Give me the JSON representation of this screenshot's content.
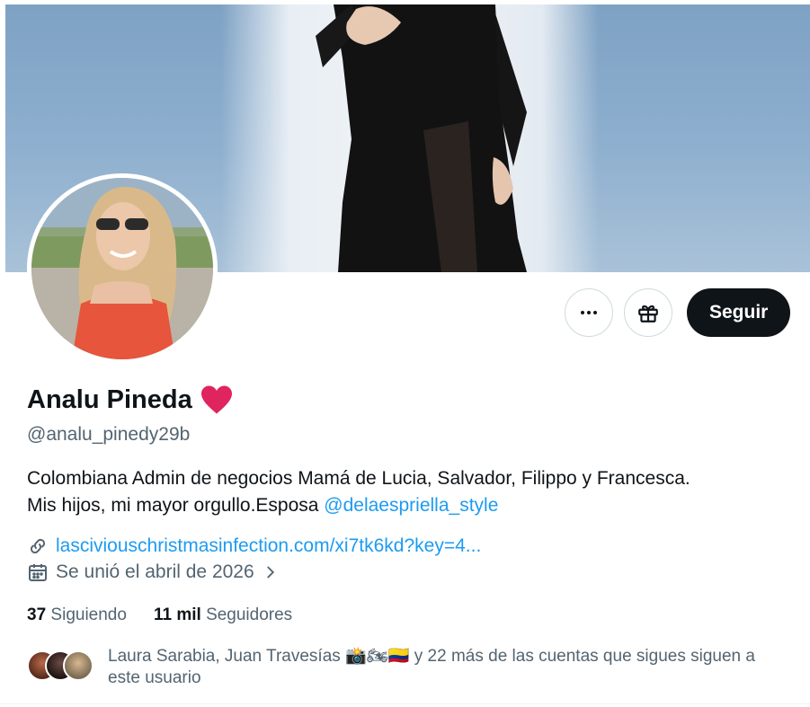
{
  "profile": {
    "name": "Analu Pineda",
    "name_emoji": "❤",
    "handle": "@analu_pinedy29b",
    "bio_line1": "Colombiana  Admin de negocios  Mamá de Lucia, Salvador, Filippo y Francesca.",
    "bio_line2": "Mis hijos, mi mayor orgullo.Esposa ",
    "bio_mention": "@delaespriella_style",
    "link": "lasciviouschristmasinfection.com/xi7tk6kd?key=4...",
    "joined": "Se unió el abril de 2026"
  },
  "actions": {
    "more_icon": "more-icon",
    "gift_icon": "gift-icon",
    "follow_label": "Seguir"
  },
  "stats": {
    "following_count": "37",
    "following_label": "Siguiendo",
    "followers_count": "11 mil",
    "followers_label": "Seguidores"
  },
  "followed_by": {
    "text_before": "Laura Sarabia, Juan Travesías ",
    "emojis": "📸🏍🇨🇴",
    "text_after": " y 22 más de las cuentas que sigues siguen a este usuario"
  },
  "colors": {
    "accent": "#1d9bf0",
    "text_primary": "#0f1419",
    "text_secondary": "#536471",
    "heart": "#e0245e"
  }
}
